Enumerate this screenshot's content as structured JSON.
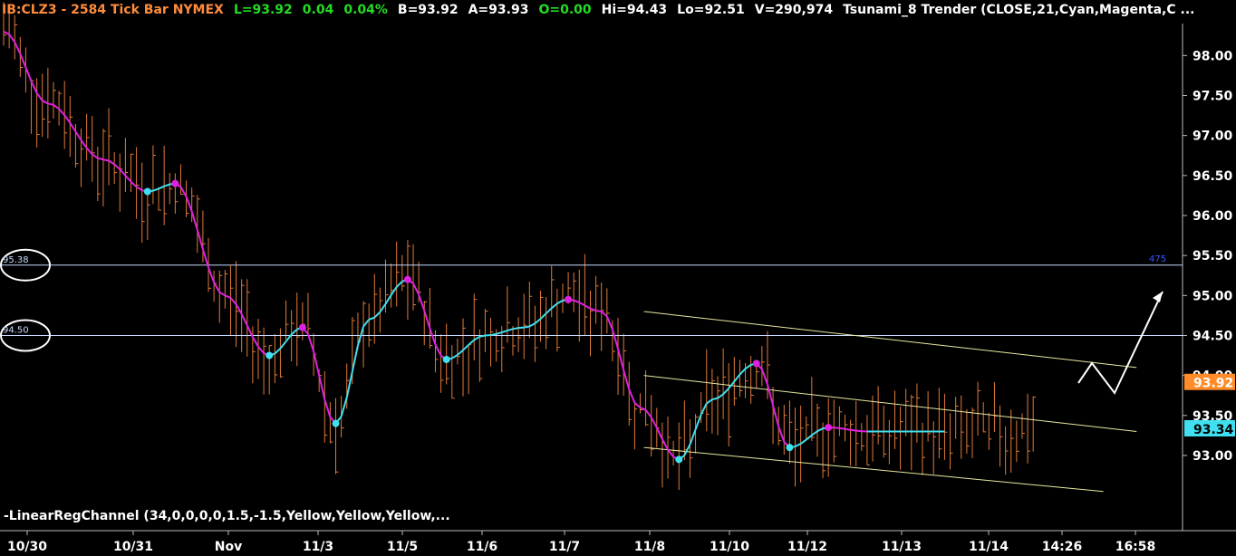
{
  "header": {
    "symbol": "IB:CLZ3 - 2584 Tick Bar  NYMEX",
    "last": "L=93.92",
    "change": "0.04",
    "change_pct": "0.04%",
    "bid": "B=93.92",
    "ask": "A=93.93",
    "open": "O=0.00",
    "high": "Hi=94.43",
    "low": "Lo=92.51",
    "volume": "V=290,974",
    "study": "Tsunami_8 Trender (CLOSE,21,Cyan,Magenta,C ..."
  },
  "indicator_label": "-LinearRegChannel (34,0,0,0,0,1.5,-1.5,Yellow,Yellow,Yellow,...",
  "colors": {
    "bars": "#e07a3a",
    "up": "#40e0f0",
    "down": "#e020e0",
    "channel": "#e8e8a0",
    "hline": "#c8d8ff",
    "header_symbol": "#ff8c3c",
    "header_green": "#22dd22",
    "last_tag": "#ff8c28",
    "trend_tag": "#40e0f0"
  },
  "chart_data": {
    "type": "candlestick",
    "title": "IB:CLZ3 - 2584 Tick Bar  NYMEX",
    "ylim": [
      92.4,
      98.4
    ],
    "y_ticks": [
      "98.00",
      "97.50",
      "97.00",
      "96.50",
      "96.00",
      "95.50",
      "95.00",
      "94.50",
      "94.00",
      "93.50",
      "93.00"
    ],
    "x_ticks": [
      "10/30",
      "10/31",
      "Nov",
      "11/3",
      "11/5",
      "11/6",
      "11/7",
      "11/8",
      "11/10",
      "11/12",
      "11/13",
      "11/14",
      "14:26",
      "16:58"
    ],
    "price_tags": [
      {
        "label": "93.92",
        "value": 93.92,
        "role": "last"
      },
      {
        "label": "93.34",
        "value": 93.34,
        "role": "trend"
      }
    ],
    "horizontal_lines": [
      {
        "label": "95.38",
        "value": 95.38,
        "right_label": "475"
      },
      {
        "label": "94.50",
        "value": 94.5,
        "right_label": ""
      }
    ],
    "trender_series": {
      "name": "Tsunami_8 Trender",
      "x_index": [
        0,
        8,
        18,
        26,
        31,
        40,
        48,
        54,
        60,
        66,
        73,
        80,
        87,
        94,
        102,
        108,
        115,
        122,
        128,
        136,
        142,
        149,
        156,
        162,
        166,
        172,
        180,
        186,
        192,
        198,
        204,
        210
      ],
      "values": [
        98.3,
        97.4,
        96.7,
        96.3,
        96.4,
        95.0,
        94.25,
        94.6,
        93.4,
        94.7,
        95.2,
        94.2,
        94.5,
        94.6,
        94.95,
        94.8,
        93.6,
        92.95,
        93.7,
        94.15,
        93.1,
        93.35,
        93.3,
        93.3,
        93.3,
        93.3,
        93.3,
        93.3,
        93.3,
        93.3,
        93.3,
        93.3
      ]
    },
    "channel": {
      "upper": [
        [
          116,
          94.8
        ],
        [
          205,
          94.1
        ]
      ],
      "middle": [
        [
          116,
          94.0
        ],
        [
          205,
          93.3
        ]
      ],
      "lower": [
        [
          116,
          93.1
        ],
        [
          199,
          92.55
        ]
      ]
    },
    "projection_arrow": [
      [
        1190,
        423
      ],
      [
        1205,
        401
      ],
      [
        1230,
        434
      ],
      [
        1283,
        322
      ]
    ]
  }
}
